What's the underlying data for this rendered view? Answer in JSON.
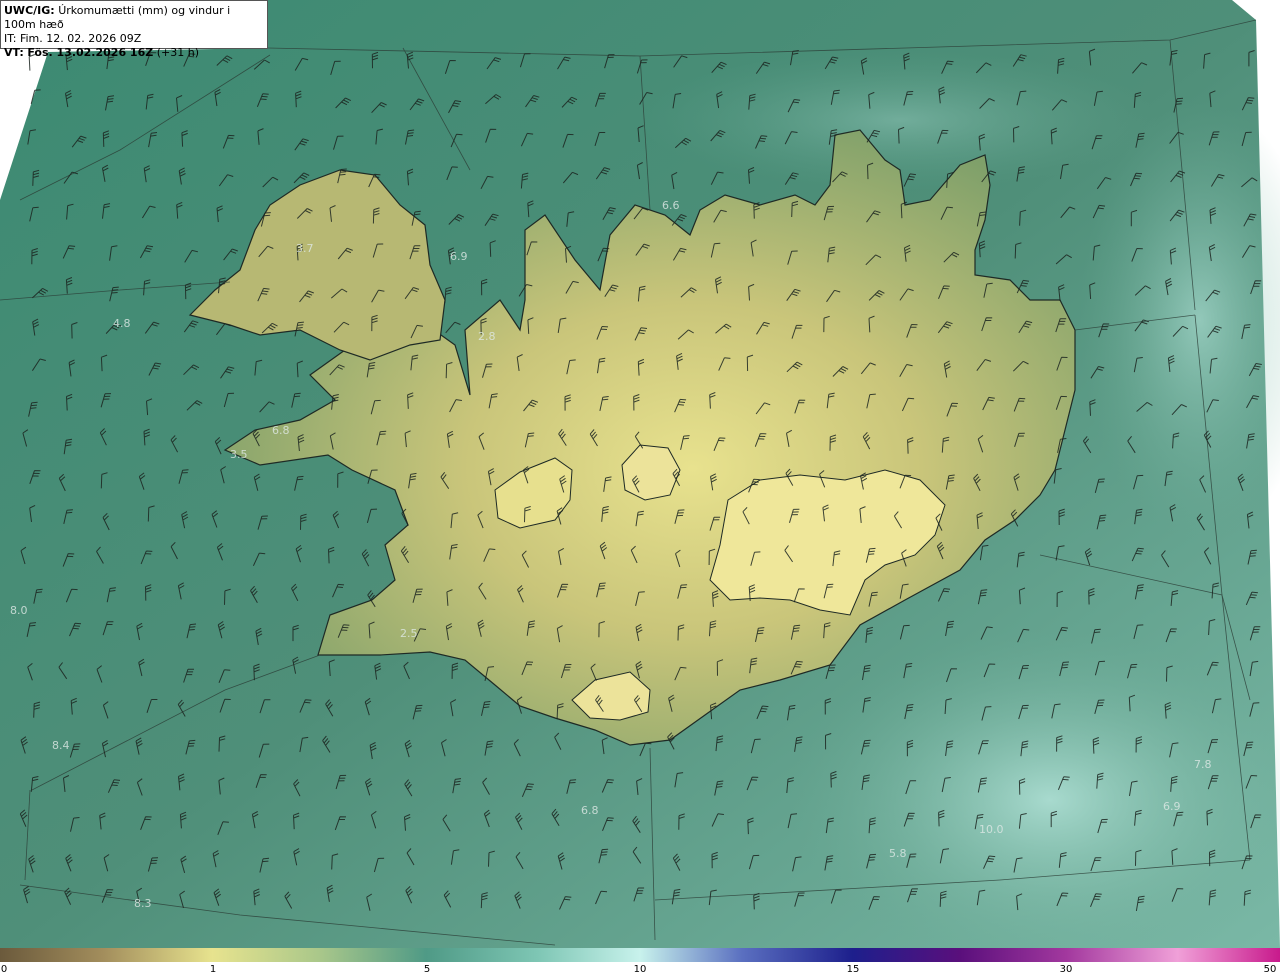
{
  "header": {
    "model": "UWC/IG:",
    "title": "Úrkomumætti (mm) og vindur i 100m hæð",
    "issue_time_prefix": "IT:",
    "issue_time": "Fim. 12. 02. 2026 09Z",
    "valid_time_prefix": "VT:",
    "valid_time": "Fös. 13.02.2026 16Z",
    "lead_time": "(+31 h)"
  },
  "colorbar": {
    "ticks": [
      "0",
      "1",
      "5",
      "10",
      "15",
      "30",
      "50"
    ],
    "colors": [
      "#6b5a3c",
      "#cdb26e",
      "#e7e38e",
      "#8dbc98",
      "#5f9e8c",
      "#b7ede6",
      "#1d1f8c",
      "#5a0f7c",
      "#f0a0d8",
      "#c81a8c"
    ]
  },
  "map": {
    "colors": {
      "background_sea": "#3f7f6b",
      "sea_light": "#6fae98",
      "land_high": "#e5e08f",
      "land_mid": "#a9b272",
      "coastline": "#1e2a25",
      "wind_barb": "#1c2520"
    },
    "value_labels": [
      "3.7",
      "6.9",
      "6.6",
      "4.8",
      "2.8",
      "6.8",
      "3.5",
      "2.5",
      "8.0",
      "8.4",
      "6.8",
      "8.3",
      "5.8",
      "10.0",
      "6.9",
      "7.8"
    ]
  }
}
